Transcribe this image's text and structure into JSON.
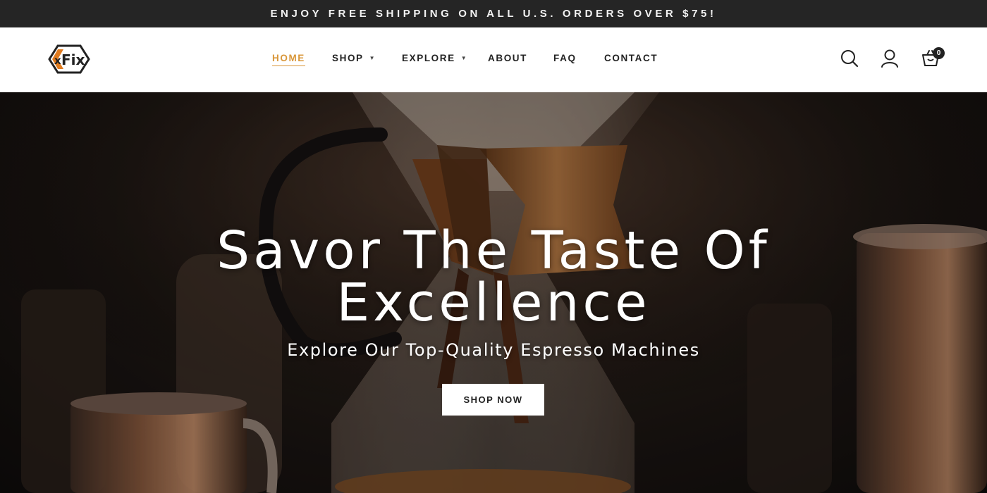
{
  "announcement": "ENJOY FREE SHIPPING ON ALL U.S. ORDERS OVER $75!",
  "logo": {
    "text": "xFix",
    "accent_color": "#e07b1f"
  },
  "nav": {
    "items": [
      {
        "label": "HOME",
        "active": true,
        "dropdown": false
      },
      {
        "label": "SHOP",
        "active": false,
        "dropdown": true
      },
      {
        "label": "EXPLORE",
        "active": false,
        "dropdown": true
      },
      {
        "label": "ABOUT",
        "active": false,
        "dropdown": false
      },
      {
        "label": "FAQ",
        "active": false,
        "dropdown": false
      },
      {
        "label": "CONTACT",
        "active": false,
        "dropdown": false
      }
    ],
    "active_color": "#d9973a"
  },
  "header_icons": {
    "search": "search-icon",
    "account": "user-icon",
    "cart": "cart-icon",
    "cart_count": "0"
  },
  "hero": {
    "title_line1": "Savor The Taste Of",
    "title_line2": "Excellence",
    "subtitle": "Explore Our Top-Quality Espresso Machines",
    "button_label": "SHOP NOW"
  }
}
